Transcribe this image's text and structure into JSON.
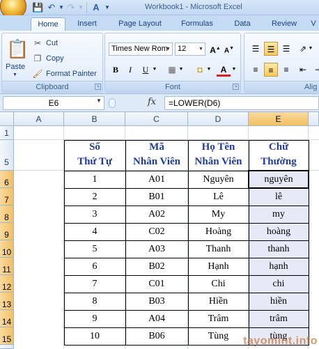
{
  "window": {
    "title": "Workbook1 - Microsoft Excel"
  },
  "tabs": [
    {
      "label": "Home",
      "active": true
    },
    {
      "label": "Insert"
    },
    {
      "label": "Page Layout"
    },
    {
      "label": "Formulas"
    },
    {
      "label": "Data"
    },
    {
      "label": "Review"
    },
    {
      "label": "V"
    }
  ],
  "ribbon": {
    "clipboard": {
      "label": "Clipboard",
      "paste": "Paste",
      "cut": "Cut",
      "copy": "Copy",
      "format_painter": "Format Painter"
    },
    "font": {
      "label": "Font",
      "name": "Times New Rom",
      "size": "12"
    },
    "alignment": {
      "label": "Alig"
    }
  },
  "formula_bar": {
    "name_box": "E6",
    "fx": "fx",
    "formula": "=LOWER(D6)"
  },
  "columns": [
    "A",
    "B",
    "C",
    "D",
    "E"
  ],
  "selected_column": "E",
  "rows": [
    "1",
    "5",
    "6",
    "7",
    "8",
    "9",
    "10",
    "11",
    "12",
    "13",
    "14",
    "15"
  ],
  "table": {
    "headers": [
      [
        "Số",
        "Thứ Tự"
      ],
      [
        "Mã",
        "Nhân Viên"
      ],
      [
        "Họ Tên",
        "Nhân Viên"
      ],
      [
        "Chữ",
        "Thường"
      ]
    ],
    "rows": [
      [
        "1",
        "A01",
        "Nguyên",
        "nguyên"
      ],
      [
        "2",
        "B01",
        "Lê",
        "lê"
      ],
      [
        "3",
        "A02",
        "My",
        "my"
      ],
      [
        "4",
        "C02",
        "Hoàng",
        "hoàng"
      ],
      [
        "5",
        "A03",
        "Thanh",
        "thanh"
      ],
      [
        "6",
        "B02",
        "Hạnh",
        "hạnh"
      ],
      [
        "7",
        "C01",
        "Chi",
        "chi"
      ],
      [
        "8",
        "B03",
        "Hiền",
        "hiền"
      ],
      [
        "9",
        "A04",
        "Trâm",
        "trâm"
      ],
      [
        "10",
        "B06",
        "Tùng",
        "tùng"
      ]
    ]
  },
  "watermark": "tayomint.info",
  "colors": {
    "header_text": "#1f3aa0",
    "selection": "#f1c15f"
  }
}
